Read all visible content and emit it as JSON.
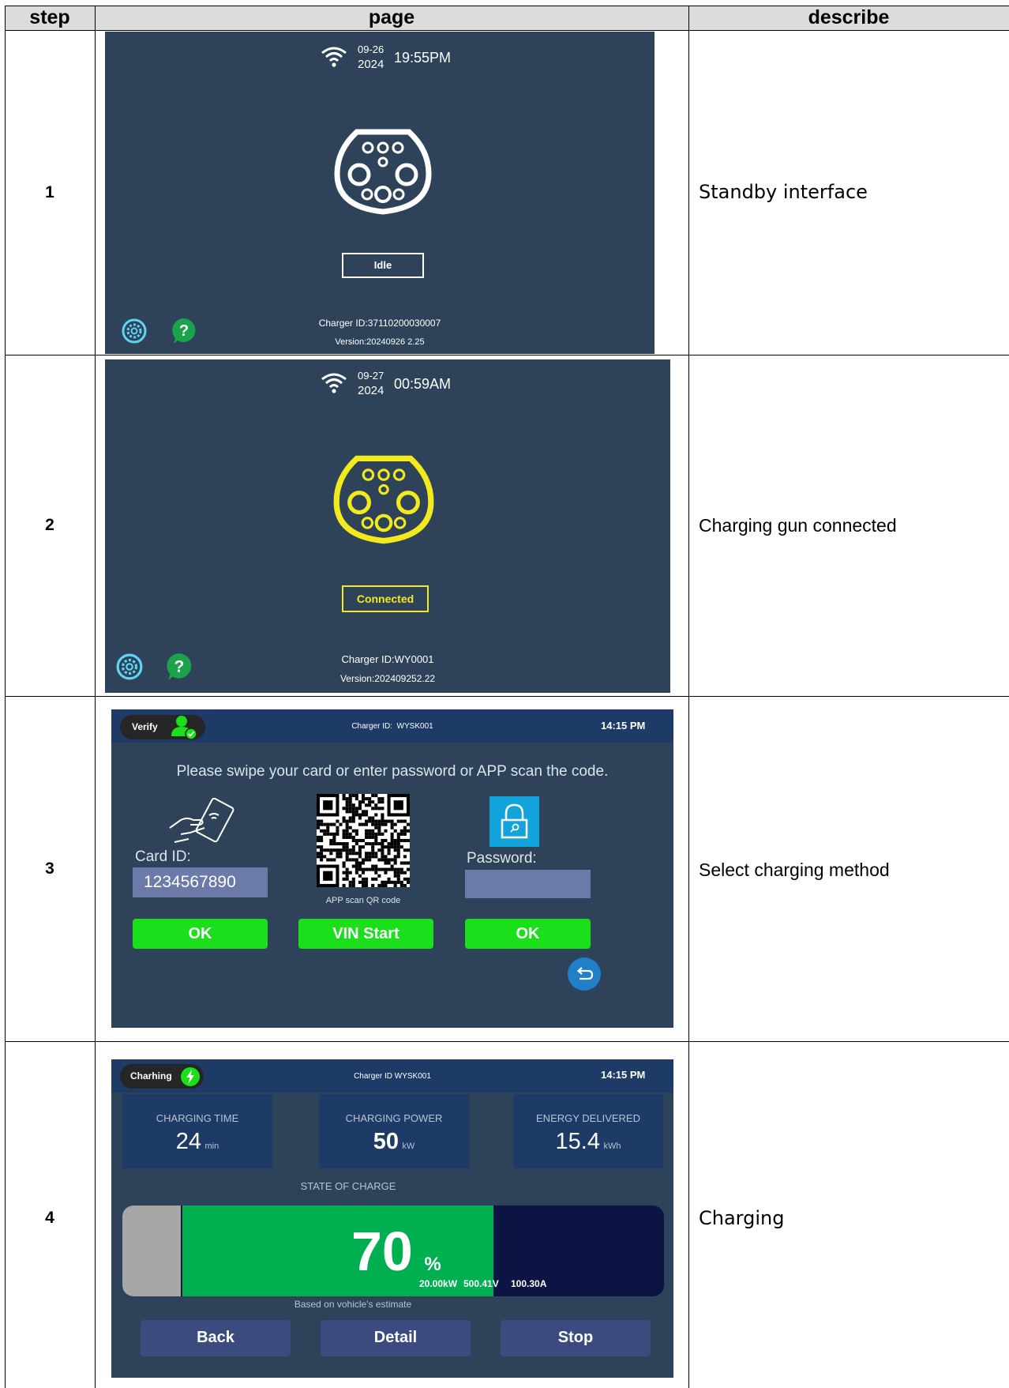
{
  "table": {
    "headers": [
      "step",
      "page",
      "describe"
    ],
    "rows": [
      {
        "step": "1",
        "describe": "Standby interface"
      },
      {
        "step": "2",
        "describe": "Charging gun connected"
      },
      {
        "step": "3",
        "describe": "Select charging method"
      },
      {
        "step": "4",
        "describe": "Charging"
      }
    ]
  },
  "screen1": {
    "date": "09-26",
    "year": "2024",
    "time": "19:55PM",
    "status": "Idle",
    "charger_id": "Charger ID:37110200030007",
    "version": "Version:20240926 2.25"
  },
  "screen2": {
    "date": "09-27",
    "year": "2024",
    "time": "00:59AM",
    "status": "Connected",
    "charger_id": "Charger ID:WY0001",
    "version": "Version:202409252.22"
  },
  "screen3": {
    "badge": "Verify",
    "charger_id": "Charger ID:  WYSK001",
    "time": "14:15 PM",
    "prompt": "Please swipe your card or enter password or APP scan the code.",
    "card_label": "Card ID:",
    "card_value": "1234567890",
    "qr_caption": "APP scan QR code",
    "password_label": "Password:",
    "password_value": "",
    "ok_left": "OK",
    "vin_start": "VIN Start",
    "ok_right": "OK"
  },
  "screen4": {
    "badge": "Charhing",
    "charger_id": "Charger ID WYSK001",
    "time": "14:15 PM",
    "charging_time_label": "CHARGING TIME",
    "charging_time_value": "24",
    "charging_time_unit": "min",
    "charging_power_label": "CHARGING POWER",
    "charging_power_value": "50",
    "charging_power_unit": "kW",
    "energy_label": "ENERGY DELIVERED",
    "energy_value": "15.4",
    "energy_unit": "kWh",
    "soc_label": "STATE OF CHARGE",
    "soc_value": "70",
    "soc_unit": "%",
    "soc_fraction": 0.7,
    "power_reading": "20.00kW",
    "voltage_reading": "500.41V",
    "current_reading": "100.30A",
    "estimate_note": "Based on vohicle's estimate",
    "back": "Back",
    "detail": "Detail",
    "stop": "Stop"
  },
  "colors": {
    "screen_bg": "#2e4359",
    "connected_yellow": "#f2ea1c",
    "button_green": "#1adf1a",
    "soc_green": "#00b050",
    "soc_dark": "#0b1442",
    "settings_cyan": "#5ed6f2",
    "help_green": "#1aa34a"
  }
}
